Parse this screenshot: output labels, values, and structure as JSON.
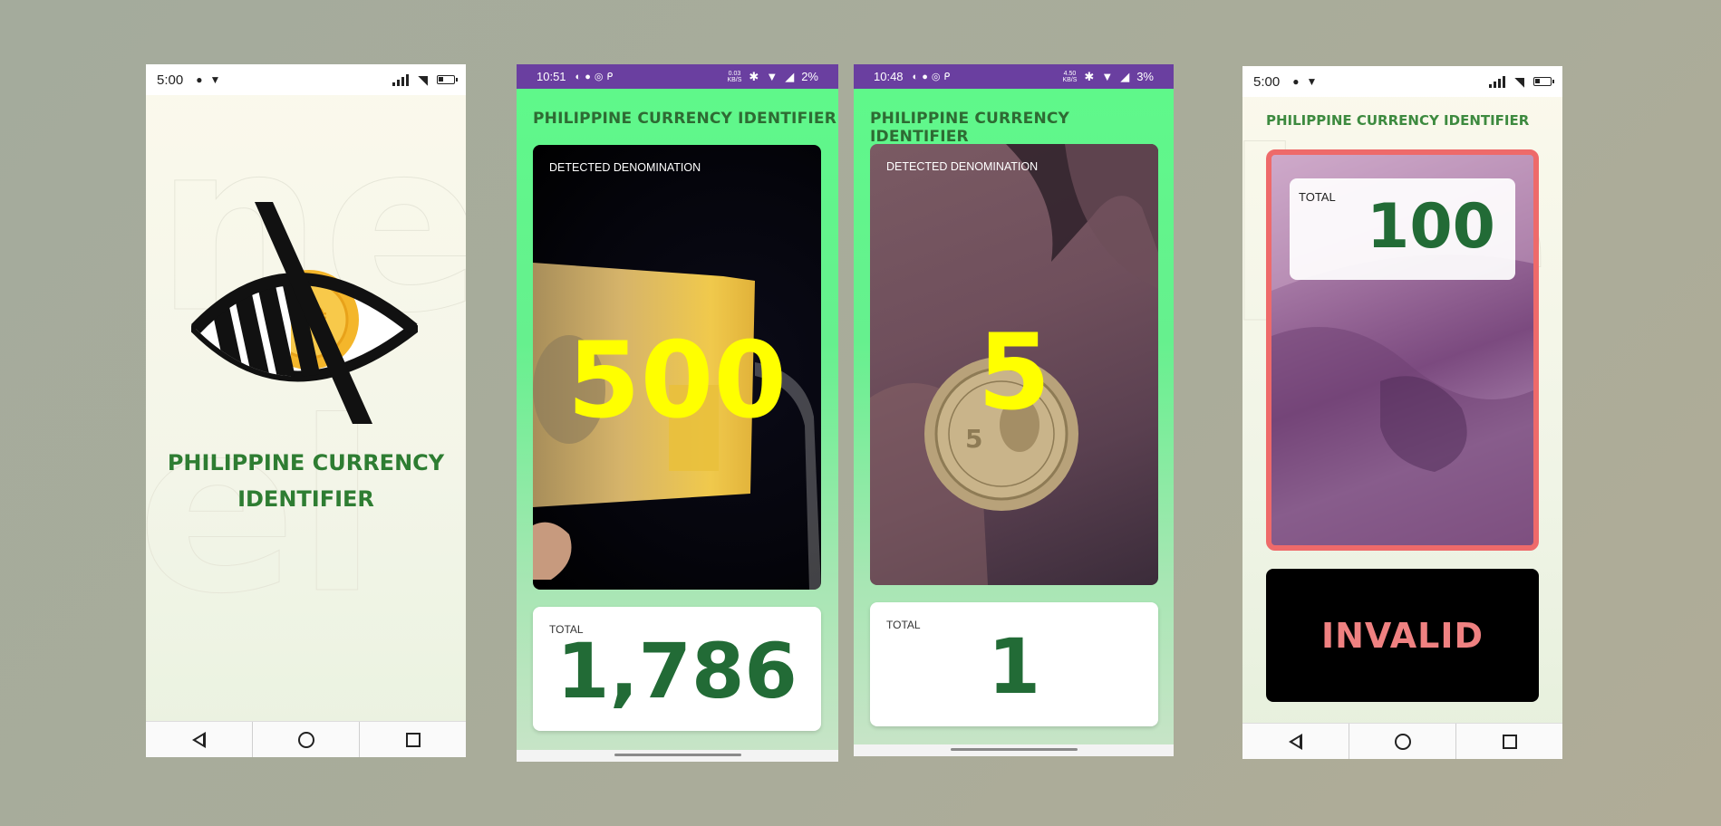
{
  "screens": [
    {
      "status": {
        "time": "5:00"
      },
      "title_line1": "PHILIPPINE CURRENCY",
      "title_line2": "IDENTIFIER",
      "nav": [
        "back",
        "home",
        "recents"
      ]
    },
    {
      "status": {
        "time": "10:51",
        "speed_top": "0.03",
        "speed_bottom": "KB/S",
        "battery": "2%"
      },
      "app_title": "PHILIPPINE CURRENCY IDENTIFIER",
      "detected_label": "DETECTED DENOMINATION",
      "detected_value": "500",
      "total_label": "TOTAL",
      "total_value": "1,786"
    },
    {
      "status": {
        "time": "10:48",
        "speed_top": "4.50",
        "speed_bottom": "KB/S",
        "battery": "3%"
      },
      "app_title": "PHILIPPINE CURRENCY IDENTIFIER",
      "detected_label": "DETECTED DENOMINATION",
      "detected_value": "5",
      "total_label": "TOTAL",
      "total_value": "1"
    },
    {
      "status": {
        "time": "5:00"
      },
      "app_title": "PHILIPPINE CURRENCY IDENTIFIER",
      "total_label": "TOTAL",
      "total_value": "100",
      "result": "INVALID",
      "nav": [
        "back",
        "home",
        "recents"
      ]
    }
  ],
  "colors": {
    "brand_green": "#2e7d32",
    "total_green": "#226b36",
    "status_purple": "#6a3fa0",
    "detected_yellow": "#ffff00",
    "invalid_red": "#ef8181",
    "frame_red": "#ee6a6a"
  },
  "icons": [
    "messenger-icon",
    "twitter-icon",
    "signal-icon",
    "wifi-icon",
    "battery-icon",
    "bluetooth-icon",
    "back-icon",
    "home-icon",
    "recents-icon",
    "eye-coin-logo-icon"
  ]
}
